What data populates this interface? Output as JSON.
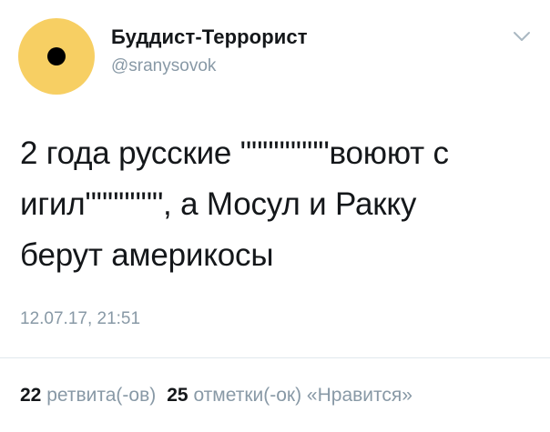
{
  "tweet": {
    "author": {
      "display_name": "Буддист-Террорист",
      "handle": "@sranysovok",
      "avatar_color": "#f7cf63"
    },
    "menu_icon": "chevron-down-icon",
    "text_lines": [
      "2 года русские \"\"\"\"\"\"\"\"воюют с",
      "игил\"\"\"\"\"\"\", а Мосул и Ракку",
      "берут америкосы"
    ],
    "timestamp": "12.07.17, 21:51",
    "stats": {
      "retweets_count": "22",
      "retweets_label": "ретвита(-ов)",
      "likes_count": "25",
      "likes_label": "отметки(-ок) «Нравится»"
    }
  }
}
